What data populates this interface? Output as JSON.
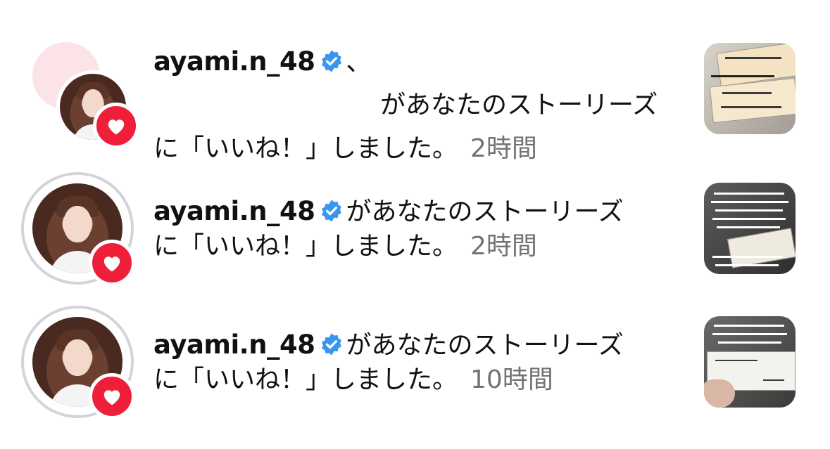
{
  "notifications": [
    {
      "username": "ayami.n_48",
      "joiner": "、",
      "line1_rest": "があなたのストーリーズ",
      "line2": "に「いいね！」しました。",
      "time": "2時間",
      "avatar_style": "group",
      "thumb_style": "tickets"
    },
    {
      "username": "ayami.n_48",
      "joiner": "",
      "line1_rest": "があなたのストーリーズ",
      "line2": "に「いいね！」しました。",
      "time": "2時間",
      "avatar_style": "single",
      "thumb_style": "text-card"
    },
    {
      "username": "ayami.n_48",
      "joiner": "",
      "line1_rest": "があなたのストーリーズ",
      "line2": "に「いいね！」しました。",
      "time": "10時間",
      "avatar_style": "single",
      "thumb_style": "handheld-ticket"
    }
  ],
  "icons": {
    "verified": "verified-badge-icon",
    "heart": "heart-icon"
  },
  "colors": {
    "verified_blue": "#3797f0",
    "heart_red": "#ef1f3a",
    "time_gray": "#737373"
  }
}
